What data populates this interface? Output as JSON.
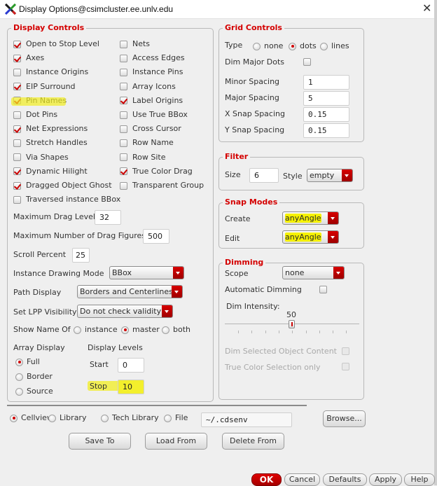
{
  "window": {
    "title": "Display Options@csimcluster.ee.unlv.edu",
    "app_icon": "x-logo-icon",
    "close_icon": "close-icon"
  },
  "display_controls": {
    "title": "Display Controls",
    "checkboxes_left": [
      {
        "label": "Open to Stop Level",
        "checked": true
      },
      {
        "label": "Axes",
        "checked": true
      },
      {
        "label": "Instance Origins",
        "checked": false
      },
      {
        "label": "EIP Surround",
        "checked": true
      },
      {
        "label": "Pin Names",
        "checked": true,
        "highlighted": true
      },
      {
        "label": "Dot Pins",
        "checked": false
      },
      {
        "label": "Net Expressions",
        "checked": true
      },
      {
        "label": "Stretch Handles",
        "checked": false
      },
      {
        "label": "Via Shapes",
        "checked": false
      },
      {
        "label": "Dynamic Hilight",
        "checked": true
      },
      {
        "label": "Dragged Object Ghost",
        "checked": true
      },
      {
        "label": "Traversed instance BBox",
        "checked": false
      }
    ],
    "checkboxes_right": [
      {
        "label": "Nets",
        "checked": false
      },
      {
        "label": "Access Edges",
        "checked": false
      },
      {
        "label": "Instance Pins",
        "checked": false
      },
      {
        "label": "Array Icons",
        "checked": false
      },
      {
        "label": "Label Origins",
        "checked": true
      },
      {
        "label": "Use True BBox",
        "checked": false
      },
      {
        "label": "Cross Cursor",
        "checked": false
      },
      {
        "label": "Row Name",
        "checked": false
      },
      {
        "label": "Row Site",
        "checked": false
      },
      {
        "label": "True Color Drag",
        "checked": true
      },
      {
        "label": "Transparent Group",
        "checked": false
      }
    ],
    "max_drag_level": {
      "label": "Maximum Drag Level",
      "value": "32"
    },
    "max_drag_figures": {
      "label": "Maximum Number of Drag Figures",
      "value": "500"
    },
    "scroll_percent": {
      "label": "Scroll Percent",
      "value": "25"
    },
    "instance_drawing_mode": {
      "label": "Instance Drawing Mode",
      "value": "BBox"
    },
    "path_display": {
      "label": "Path Display",
      "value": "Borders and Centerlines"
    },
    "lpp_visibility": {
      "label": "Set LPP Visibility",
      "value": "Do not check validity"
    },
    "show_name_of": {
      "label": "Show Name Of",
      "options": [
        {
          "label": "instance",
          "selected": false
        },
        {
          "label": "master",
          "selected": true
        },
        {
          "label": "both",
          "selected": false
        }
      ]
    },
    "array_display": {
      "label": "Array Display",
      "options": [
        {
          "label": "Full",
          "selected": true
        },
        {
          "label": "Border",
          "selected": false
        },
        {
          "label": "Source",
          "selected": false
        }
      ]
    },
    "display_levels": {
      "label": "Display Levels",
      "start_label": "Start",
      "start_value": "0",
      "stop_label": "Stop",
      "stop_value": "10"
    }
  },
  "grid_controls": {
    "title": "Grid Controls",
    "type_label": "Type",
    "type_options": [
      {
        "label": "none",
        "selected": false
      },
      {
        "label": "dots",
        "selected": true
      },
      {
        "label": "lines",
        "selected": false
      }
    ],
    "dim_major_dots": {
      "label": "Dim Major Dots",
      "checked": false
    },
    "minor_spacing": {
      "label": "Minor Spacing",
      "value": "1"
    },
    "major_spacing": {
      "label": "Major Spacing",
      "value": "5"
    },
    "x_snap_spacing": {
      "label": "X Snap Spacing",
      "value": "0.15"
    },
    "y_snap_spacing": {
      "label": "Y Snap Spacing",
      "value": "0.15"
    }
  },
  "filter": {
    "title": "Filter",
    "size_label": "Size",
    "size_value": "6",
    "style_label": "Style",
    "style_value": "empty"
  },
  "snap_modes": {
    "title": "Snap Modes",
    "create_label": "Create",
    "create_value": "anyAngle",
    "edit_label": "Edit",
    "edit_value": "anyAngle"
  },
  "dimming": {
    "title": "Dimming",
    "scope_label": "Scope",
    "scope_value": "none",
    "automatic_dimming": {
      "label": "Automatic Dimming",
      "checked": false
    },
    "dim_intensity_label": "Dim Intensity:",
    "dim_intensity_value": "50",
    "dim_intensity_fraction": 0.5,
    "dim_selected_object_content": {
      "label": "Dim Selected Object Content",
      "checked": false,
      "disabled": true
    },
    "true_color_selection_only": {
      "label": "True Color Selection only",
      "checked": false,
      "disabled": true
    }
  },
  "save_location": {
    "options": [
      {
        "label": "Cellview",
        "selected": true
      },
      {
        "label": "Library",
        "selected": false
      },
      {
        "label": "Tech Library",
        "selected": false
      },
      {
        "label": "File",
        "selected": false
      }
    ],
    "file_value": "~/.cdsenv",
    "browse_label": "Browse...",
    "save_to_label": "Save To",
    "load_from_label": "Load From",
    "delete_from_label": "Delete From"
  },
  "footer": {
    "ok_label": "OK",
    "cancel_label": "Cancel",
    "defaults_label": "Defaults",
    "apply_label": "Apply",
    "help_label": "Help"
  }
}
